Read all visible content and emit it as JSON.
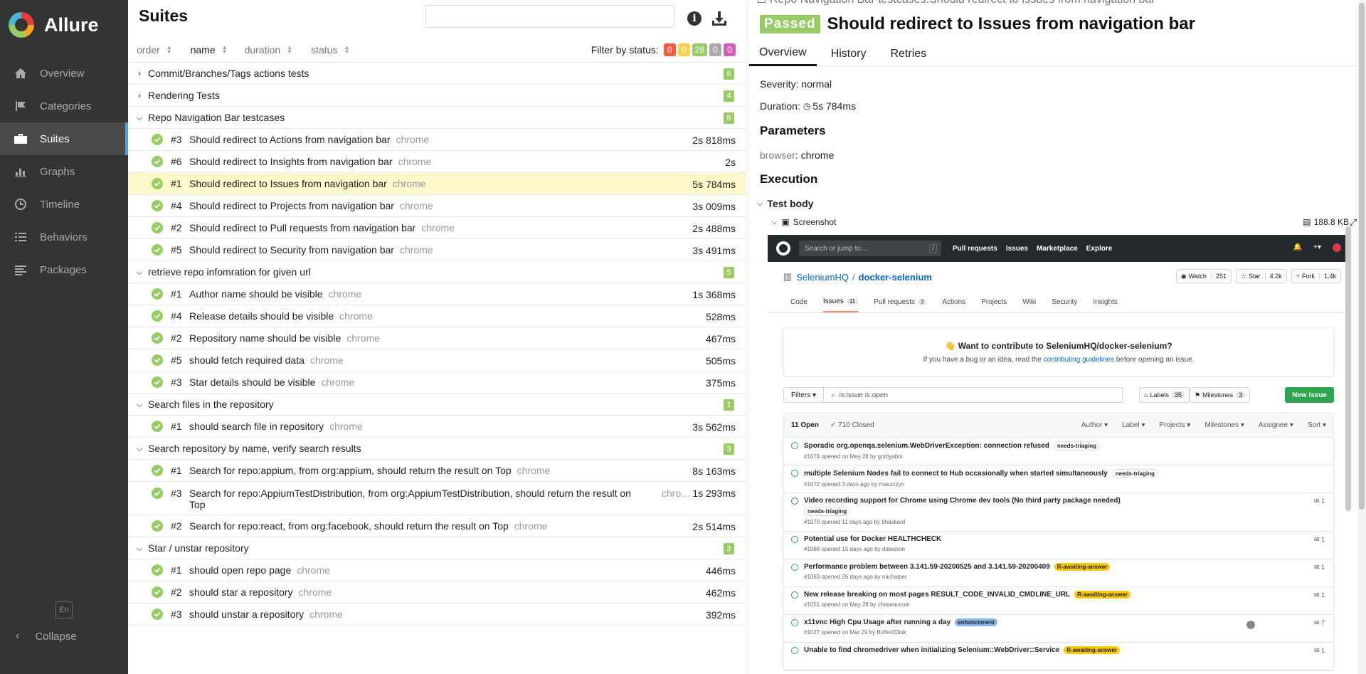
{
  "sidebar": {
    "app_name": "Allure",
    "items": [
      {
        "label": "Overview",
        "icon": "home-icon"
      },
      {
        "label": "Categories",
        "icon": "flag-icon"
      },
      {
        "label": "Suites",
        "icon": "briefcase-icon"
      },
      {
        "label": "Graphs",
        "icon": "bar-chart-icon"
      },
      {
        "label": "Timeline",
        "icon": "clock-icon"
      },
      {
        "label": "Behaviors",
        "icon": "list-icon"
      },
      {
        "label": "Packages",
        "icon": "align-left-icon"
      }
    ],
    "active": "Suites",
    "language": "En",
    "collapse_label": "Collapse"
  },
  "suites": {
    "title": "Suites",
    "sort": {
      "order": "order",
      "name": "name",
      "duration": "duration",
      "status": "status"
    },
    "filter_label": "Filter by status:",
    "filter_counts": [
      {
        "value": "0",
        "color": "#fd5a3e"
      },
      {
        "value": "0",
        "color": "#ffd050"
      },
      {
        "value": "28",
        "color": "#97cc64"
      },
      {
        "value": "0",
        "color": "#aaaaaa"
      },
      {
        "value": "0",
        "color": "#d35ebe"
      }
    ],
    "groups": [
      {
        "name": "Commit/Branches/Tags actions tests",
        "count": "6",
        "expanded": false,
        "tests": []
      },
      {
        "name": "Rendering Tests",
        "count": "4",
        "expanded": false,
        "tests": []
      },
      {
        "name": "Repo Navigation Bar testcases",
        "count": "6",
        "expanded": true,
        "tests": [
          {
            "num": "#3",
            "name": "Should redirect to Actions from navigation bar",
            "browser": "chrome",
            "duration": "2s 818ms"
          },
          {
            "num": "#6",
            "name": "Should redirect to Insights from navigation bar",
            "browser": "chrome",
            "duration": "2s"
          },
          {
            "num": "#1",
            "name": "Should redirect to Issues from navigation bar",
            "browser": "chrome",
            "duration": "5s 784ms",
            "selected": true
          },
          {
            "num": "#4",
            "name": "Should redirect to Projects from navigation bar",
            "browser": "chrome",
            "duration": "3s 009ms"
          },
          {
            "num": "#2",
            "name": "Should redirect to Pull requests from navigation bar",
            "browser": "chrome",
            "duration": "2s 488ms"
          },
          {
            "num": "#5",
            "name": "Should redirect to Security from navigation bar",
            "browser": "chrome",
            "duration": "3s 491ms"
          }
        ]
      },
      {
        "name": "retrieve repo infomration for given url",
        "count": "5",
        "expanded": true,
        "tests": [
          {
            "num": "#1",
            "name": "Author name should be visible",
            "browser": "chrome",
            "duration": "1s 368ms"
          },
          {
            "num": "#4",
            "name": "Release details should be visible",
            "browser": "chrome",
            "duration": "528ms"
          },
          {
            "num": "#2",
            "name": "Repository name should be visible",
            "browser": "chrome",
            "duration": "467ms"
          },
          {
            "num": "#5",
            "name": "should fetch required data",
            "browser": "chrome",
            "duration": "505ms"
          },
          {
            "num": "#3",
            "name": "Star details should be visible",
            "browser": "chrome",
            "duration": "375ms"
          }
        ]
      },
      {
        "name": "Search files in the repository",
        "count": "1",
        "expanded": true,
        "tests": [
          {
            "num": "#1",
            "name": "should search file in repository",
            "browser": "chrome",
            "duration": "3s 562ms"
          }
        ]
      },
      {
        "name": "Search repository by name, verify search results",
        "count": "3",
        "expanded": true,
        "tests": [
          {
            "num": "#1",
            "name": "Search for repo:appium, from org:appium, should return the result on Top",
            "browser": "chrome",
            "duration": "8s 163ms"
          },
          {
            "num": "#3",
            "name": "Search for repo:AppiumTestDistribution, from org:AppiumTestDistribution, should return the result on Top",
            "browser": "chro…",
            "duration": "1s 293ms",
            "wrap": true
          },
          {
            "num": "#2",
            "name": "Search for repo:react, from org:facebook, should return the result on Top",
            "browser": "chrome",
            "duration": "2s 514ms"
          }
        ]
      },
      {
        "name": "Star / unstar repository",
        "count": "3",
        "expanded": true,
        "tests": [
          {
            "num": "#1",
            "name": "should open repo page",
            "browser": "chrome",
            "duration": "446ms"
          },
          {
            "num": "#2",
            "name": "should star a repository",
            "browser": "chrome",
            "duration": "462ms"
          },
          {
            "num": "#3",
            "name": "should unstar a repository",
            "browser": "chrome",
            "duration": "392ms"
          }
        ]
      }
    ]
  },
  "detail": {
    "breadcrumb": "Repo Navigation Bar testcases.Should redirect to Issues from navigation bar",
    "status": "Passed",
    "title": "Should redirect to Issues from navigation bar",
    "tabs": [
      "Overview",
      "History",
      "Retries"
    ],
    "severity_label": "Severity: normal",
    "duration_label": "Duration:",
    "duration_value": "5s 784ms",
    "parameters_heading": "Parameters",
    "param_key": "browser",
    "param_value": ": chrome",
    "execution_heading": "Execution",
    "test_body_label": "Test body",
    "screenshot_label": "Screenshot",
    "screenshot_size": "188.8 KB"
  },
  "github": {
    "search_placeholder": "Search or jump to...",
    "search_key": "/",
    "top_nav": [
      "Pull requests",
      "Issues",
      "Marketplace",
      "Explore"
    ],
    "org": "SeleniumHQ",
    "separator": "/",
    "repo": "docker-selenium",
    "watch_label": "Watch",
    "watch_count": "251",
    "star_label": "Star",
    "star_count": "4.2k",
    "fork_label": "Fork",
    "fork_count": "1.4k",
    "tabs": [
      {
        "label": "Code",
        "count": ""
      },
      {
        "label": "Issues",
        "count": "11"
      },
      {
        "label": "Pull requests",
        "count": "3"
      },
      {
        "label": "Actions",
        "count": ""
      },
      {
        "label": "Projects",
        "count": ""
      },
      {
        "label": "Wiki",
        "count": ""
      },
      {
        "label": "Security",
        "count": ""
      },
      {
        "label": "Insights",
        "count": ""
      }
    ],
    "contrib_title": "👋 Want to contribute to SeleniumHQ/docker-selenium?",
    "contrib_text_pre": "If you have a bug or an idea, read the ",
    "contrib_link": "contributing guidelines",
    "contrib_text_post": " before opening an issue.",
    "filters_label": "Filters ▾",
    "filter_query": "is:issue is:open",
    "labels_label": "Labels",
    "labels_count": "35",
    "milestones_label": "Milestones",
    "milestones_count": "3",
    "new_issue_label": "New issue",
    "open_label": "11 Open",
    "closed_label": "✓ 710 Closed",
    "sort_menus": [
      "Author ▾",
      "Label ▾",
      "Projects ▾",
      "Milestones ▾",
      "Assignee ▾",
      "Sort ▾"
    ],
    "issues": [
      {
        "title": "Sporadic org.openqa.selenium.WebDriverException: connection refused",
        "label": "needs-triaging",
        "label_color": "#ffffff",
        "sub": "#1074 opened on May 28 by gorbysbm",
        "comments": ""
      },
      {
        "title": "multiple Selenium Nodes fail to connect to Hub occasionally when started simultaneously",
        "label": "needs-triaging",
        "label_color": "#ffffff",
        "sub": "#1072 opened 3 days ago by maszczyn",
        "comments": ""
      },
      {
        "title": "Video recording support for Chrome using Chrome dev tools (No third party package needed)",
        "label": "needs-triaging",
        "label_color": "#ffffff",
        "sub": "#1070 opened 11 days ago by bhaskard",
        "comments": "1",
        "tall": true
      },
      {
        "title": "Potential use for Docker HEALTHCHECK",
        "label": "",
        "label_color": "",
        "sub": "#1068 opened 15 days ago by ddavison",
        "comments": "1"
      },
      {
        "title": "Performance problem between 3.141.59-20200525 and 3.141.59-20200409",
        "label": "R-awaiting-answer",
        "label_color": "#fbca04",
        "sub": "#1063 opened 26 days ago by michalper",
        "comments": "1"
      },
      {
        "title": "New release breaking on most pages RESULT_CODE_INVALID_CMDLINE_URL",
        "label": "R-awaiting-answer",
        "label_color": "#fbca04",
        "sub": "#1051 opened on May 28 by chaseaucoin",
        "comments": "1"
      },
      {
        "title": "x11vnc High Cpu Usage after running a day",
        "label": "enhancement",
        "label_color": "#84b6eb",
        "sub": "#1027 opened on Mar 29 by Buffer2Disk",
        "comments": "7",
        "avatar": true
      },
      {
        "title": "Unable to find chromedriver when initializing Selenium::WebDriver::Service",
        "label": "R-awaiting-answer",
        "label_color": "#fbca04",
        "sub": "",
        "comments": "1"
      }
    ]
  }
}
